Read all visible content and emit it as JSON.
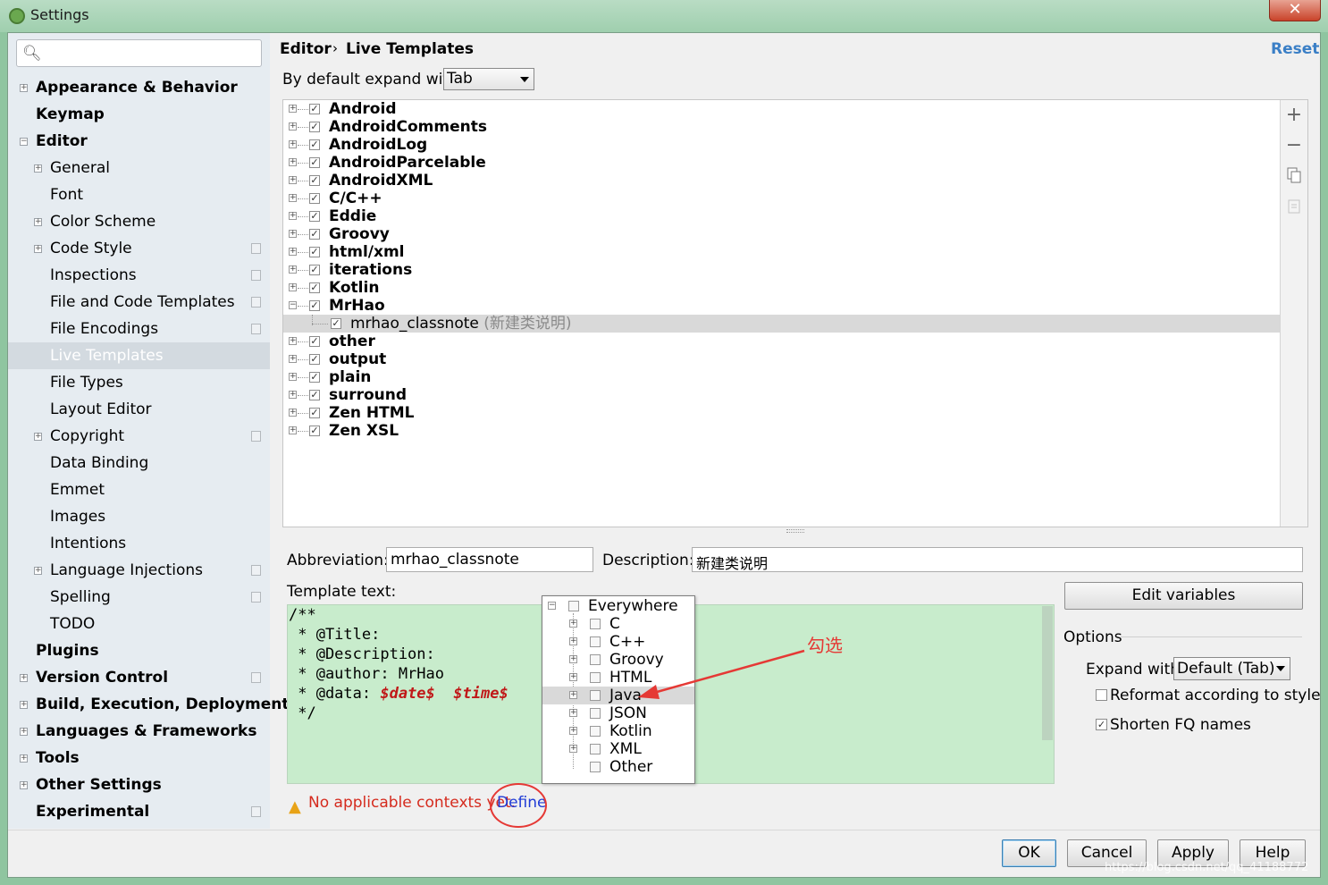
{
  "window": {
    "title": "Settings",
    "close_icon": "✕"
  },
  "search": {
    "placeholder": "",
    "icon": "search-icon"
  },
  "sidebar": {
    "items": [
      {
        "label": "Appearance & Behavior",
        "expander": "+",
        "bold": true
      },
      {
        "label": "Keymap",
        "bold": true
      },
      {
        "label": "Editor",
        "expander": "−",
        "bold": true
      },
      {
        "label": "General",
        "expander": "+"
      },
      {
        "label": "Font"
      },
      {
        "label": "Color Scheme",
        "expander": "+"
      },
      {
        "label": "Code Style",
        "expander": "+",
        "project_icon": true
      },
      {
        "label": "Inspections",
        "project_icon": true
      },
      {
        "label": "File and Code Templates",
        "project_icon": true
      },
      {
        "label": "File Encodings",
        "project_icon": true
      },
      {
        "label": "Live Templates",
        "selected": true
      },
      {
        "label": "File Types"
      },
      {
        "label": "Layout Editor"
      },
      {
        "label": "Copyright",
        "expander": "+",
        "project_icon": true
      },
      {
        "label": "Data Binding"
      },
      {
        "label": "Emmet"
      },
      {
        "label": "Images"
      },
      {
        "label": "Intentions"
      },
      {
        "label": "Language Injections",
        "expander": "+",
        "project_icon": true
      },
      {
        "label": "Spelling",
        "project_icon": true
      },
      {
        "label": "TODO"
      },
      {
        "label": "Plugins",
        "bold": true
      },
      {
        "label": "Version Control",
        "expander": "+",
        "bold": true,
        "project_icon": true
      },
      {
        "label": "Build, Execution, Deployment",
        "expander": "+",
        "bold": true
      },
      {
        "label": "Languages & Frameworks",
        "expander": "+",
        "bold": true
      },
      {
        "label": "Tools",
        "expander": "+",
        "bold": true
      },
      {
        "label": "Other Settings",
        "expander": "+",
        "bold": true
      },
      {
        "label": "Experimental",
        "bold": true,
        "project_icon": true
      }
    ]
  },
  "header": {
    "breadcrumb_parent": "Editor",
    "breadcrumb_sep": "›",
    "breadcrumb_current": "Live Templates",
    "reset": "Reset"
  },
  "default_expand": {
    "label": "By default expand with",
    "value": "Tab"
  },
  "template_groups": [
    {
      "name": "Android",
      "checked": true,
      "expander": "+"
    },
    {
      "name": "AndroidComments",
      "checked": true,
      "expander": "+"
    },
    {
      "name": "AndroidLog",
      "checked": true,
      "expander": "+"
    },
    {
      "name": "AndroidParcelable",
      "checked": true,
      "expander": "+"
    },
    {
      "name": "AndroidXML",
      "checked": true,
      "expander": "+"
    },
    {
      "name": "C/C++",
      "checked": true,
      "expander": "+"
    },
    {
      "name": "Eddie",
      "checked": true,
      "expander": "+"
    },
    {
      "name": "Groovy",
      "checked": true,
      "expander": "+"
    },
    {
      "name": "html/xml",
      "checked": true,
      "expander": "+"
    },
    {
      "name": "iterations",
      "checked": true,
      "expander": "+"
    },
    {
      "name": "Kotlin",
      "checked": true,
      "expander": "+"
    },
    {
      "name": "MrHao",
      "checked": true,
      "expander": "−"
    },
    {
      "name": "mrhao_classnote",
      "desc": "(新建类说明)",
      "checked": true,
      "child": true,
      "selected": true
    },
    {
      "name": "other",
      "checked": true,
      "expander": "+"
    },
    {
      "name": "output",
      "checked": true,
      "expander": "+"
    },
    {
      "name": "plain",
      "checked": true,
      "expander": "+"
    },
    {
      "name": "surround",
      "checked": true,
      "expander": "+"
    },
    {
      "name": "Zen HTML",
      "checked": true,
      "expander": "+"
    },
    {
      "name": "Zen XSL",
      "checked": true,
      "expander": "+"
    }
  ],
  "toolbar": {
    "add": "+",
    "remove": "−",
    "copy": "copy-icon",
    "restore": "restore-icon"
  },
  "editor": {
    "abbreviation_label": "Abbreviation:",
    "abbreviation_value": "mrhao_classnote",
    "description_label": "Description:",
    "description_value": "新建类说明",
    "template_label": "Template text:",
    "template_lines": [
      "/**",
      " * @Title:",
      " * @Description:",
      " * @author: MrHao",
      " * @data: ",
      "$date$",
      "$time$",
      " */"
    ]
  },
  "contexts": {
    "root": "Everywhere",
    "items": [
      "C",
      "C++",
      "Groovy",
      "HTML",
      "Java",
      "JSON",
      "Kotlin",
      "XML",
      "Other"
    ],
    "highlighted": "Java"
  },
  "annotation": {
    "text": "勾选",
    "color": "#e53935"
  },
  "side": {
    "edit_variables": "Edit variables",
    "options_title": "Options",
    "expand_with_label": "Expand with",
    "expand_with_value": "Default (Tab)",
    "reformat_label": "Reformat according to style",
    "reformat_checked": false,
    "shorten_label": "Shorten FQ names",
    "shorten_checked": true
  },
  "warning": {
    "text": "No applicable contexts yet.",
    "link": "Define",
    "icon": "warning-icon"
  },
  "buttons": {
    "ok": "OK",
    "cancel": "Cancel",
    "apply": "Apply",
    "help": "Help"
  },
  "watermark": "https://blog.csdn.net/qq_41188772",
  "colors": {
    "selection": "#d3dae0",
    "template_bg": "#c8eccc",
    "warning": "#d52b1e",
    "link": "#1f3bd6",
    "reset": "#3a7fc6"
  }
}
